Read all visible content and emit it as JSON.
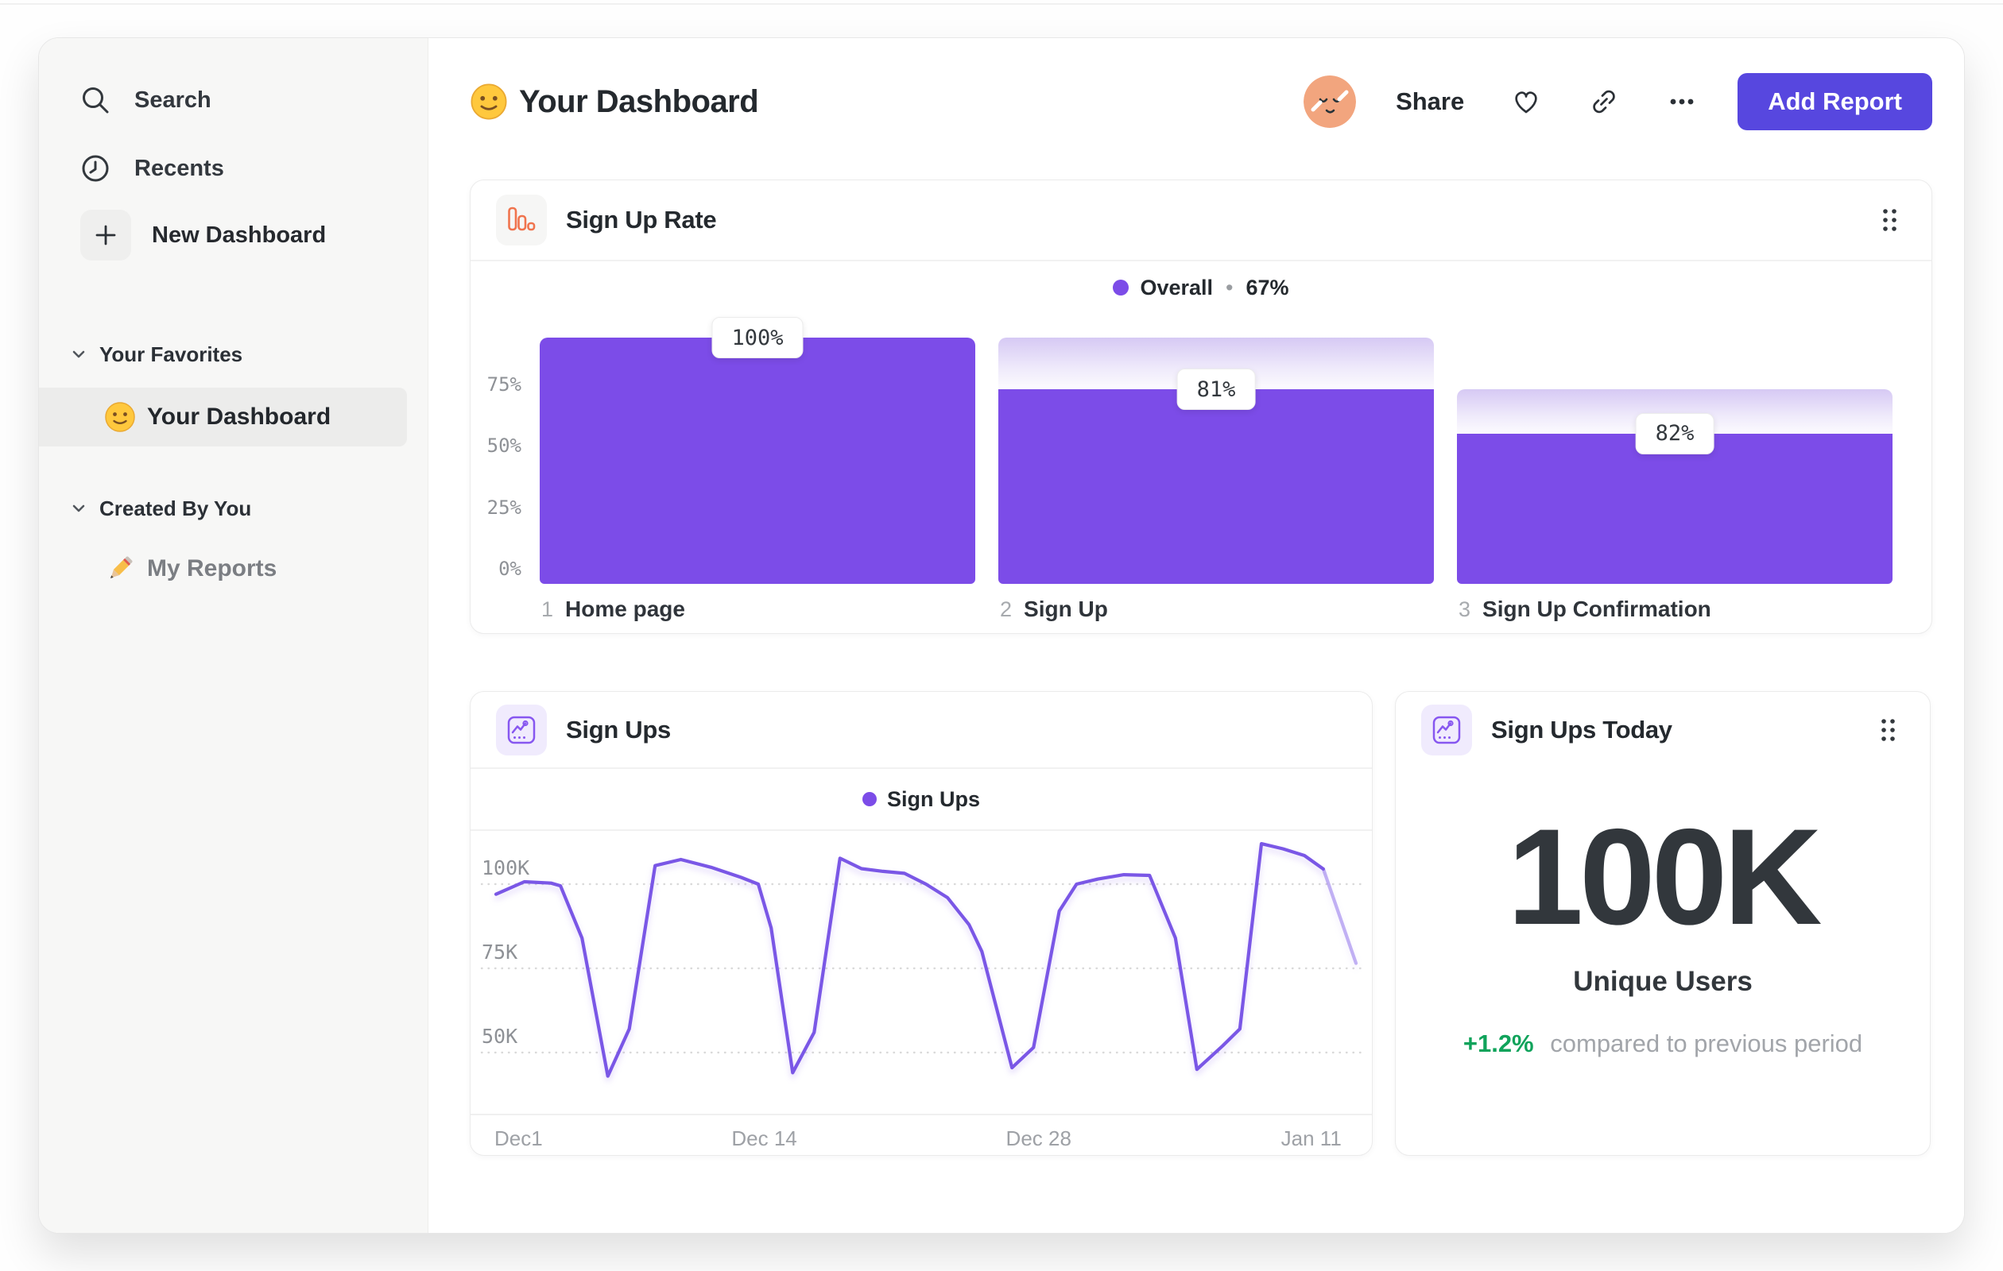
{
  "colors": {
    "accent_purple": "#7C4CE8",
    "line_purple": "#7A57E6",
    "button_purple": "#5747DF",
    "green": "#10A35B",
    "orange_icon": "#F0744E",
    "sidebar_bg": "#F7F7F6",
    "selected_row_bg": "#ECECEB",
    "gradient_top": "#D6C9F4"
  },
  "sidebar": {
    "items": [
      {
        "label": "Search",
        "icon": "search-icon"
      },
      {
        "label": "Recents",
        "icon": "clock-icon"
      },
      {
        "label": "New Dashboard",
        "icon": "plus-icon"
      }
    ],
    "sections": [
      {
        "label": "Your Favorites",
        "items": [
          {
            "label": "Your Dashboard",
            "icon": "smiley-emoji",
            "selected": true
          }
        ]
      },
      {
        "label": "Created By You",
        "items": [
          {
            "label": "My Reports",
            "icon": "pencil-emoji",
            "selected": false
          }
        ]
      }
    ]
  },
  "header": {
    "emoji": "slightly-smiling-face",
    "title": "Your Dashboard",
    "share_label": "Share",
    "add_report_label": "Add Report",
    "icons": [
      "avatar",
      "heart-icon",
      "link-icon",
      "ellipsis-icon"
    ]
  },
  "cards": {
    "funnel": {
      "title": "Sign Up Rate",
      "icon": "bar-chart-icon"
    },
    "line": {
      "title": "Sign Ups",
      "icon": "line-chart-icon"
    },
    "stat": {
      "title": "Sign Ups Today",
      "icon": "line-chart-icon",
      "value": "100K",
      "label": "Unique Users",
      "delta": "+1.2%",
      "delta_note": "compared to previous period"
    }
  },
  "chart_data": [
    {
      "type": "bar",
      "subtype": "funnel",
      "title": "Sign Up Rate",
      "legend_label": "Overall",
      "legend_separator": "•",
      "legend_value": "67%",
      "categories": [
        "Home page",
        "Sign Up",
        "Sign Up Confirmation"
      ],
      "step_indexes": [
        "1",
        "2",
        "3"
      ],
      "bar_labels": [
        "100%",
        "81%",
        "82%"
      ],
      "conversion_from_previous_pct": [
        100,
        81,
        82
      ],
      "overall_conversion_pct": 67,
      "bar_total_pct": [
        100,
        100,
        79
      ],
      "bar_solid_pct": [
        100,
        79,
        61
      ],
      "y_tick_labels": [
        "75%",
        "50%",
        "25%",
        "0%"
      ],
      "y_tick_values": [
        75,
        50,
        25,
        0
      ],
      "ylim": [
        0,
        100
      ],
      "bar_color": "#7C4CE8",
      "grid": false,
      "legend_position": "top-center"
    },
    {
      "type": "line",
      "title": "Sign Ups",
      "legend_label": "Sign Ups",
      "unit": "K",
      "x_ticks": [
        {
          "label": "Dec1",
          "f": 0.0
        },
        {
          "label": "Dec 14",
          "f": 0.312
        },
        {
          "label": "Dec 28",
          "f": 0.631
        },
        {
          "label": "Jan 11",
          "f": 0.948
        }
      ],
      "y_ticks": [
        {
          "label": "100K",
          "v": 100
        },
        {
          "label": "75K",
          "v": 75
        },
        {
          "label": "50K",
          "v": 50
        }
      ],
      "ylim": [
        40,
        115
      ],
      "grid": "dotted-horizontal",
      "legend_position": "top-center",
      "line_color": "#7A57E6",
      "faded_tail_from_index": 37,
      "points": [
        [
          0.0,
          97
        ],
        [
          0.033,
          100.7
        ],
        [
          0.064,
          100.3
        ],
        [
          0.075,
          99.5
        ],
        [
          0.1,
          84
        ],
        [
          0.13,
          43
        ],
        [
          0.155,
          57
        ],
        [
          0.185,
          105.5
        ],
        [
          0.215,
          107.3
        ],
        [
          0.25,
          105
        ],
        [
          0.285,
          102
        ],
        [
          0.305,
          100
        ],
        [
          0.32,
          87
        ],
        [
          0.345,
          44
        ],
        [
          0.37,
          56
        ],
        [
          0.4,
          107.7
        ],
        [
          0.425,
          104.6
        ],
        [
          0.45,
          103.8
        ],
        [
          0.475,
          103.2
        ],
        [
          0.5,
          100
        ],
        [
          0.525,
          96
        ],
        [
          0.55,
          88
        ],
        [
          0.565,
          80
        ],
        [
          0.6,
          45.5
        ],
        [
          0.625,
          51.5
        ],
        [
          0.655,
          92
        ],
        [
          0.675,
          100
        ],
        [
          0.7,
          101.5
        ],
        [
          0.73,
          102.8
        ],
        [
          0.76,
          102.6
        ],
        [
          0.79,
          84
        ],
        [
          0.815,
          45
        ],
        [
          0.845,
          52
        ],
        [
          0.865,
          57
        ],
        [
          0.89,
          112
        ],
        [
          0.915,
          110.5
        ],
        [
          0.94,
          108.5
        ],
        [
          0.962,
          104.5
        ],
        [
          1.0,
          76.5
        ]
      ]
    }
  ]
}
